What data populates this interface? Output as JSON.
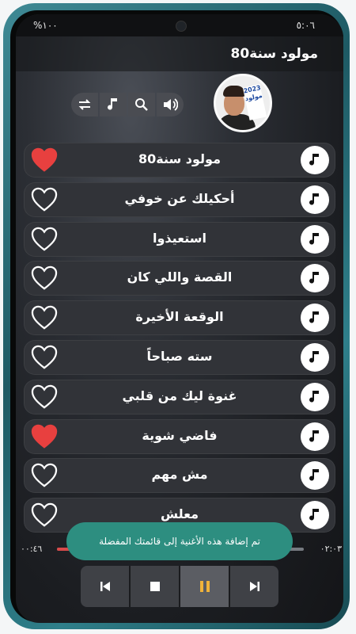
{
  "status": {
    "left": "%١٠٠",
    "right": "٥:٠٦"
  },
  "appbar": {
    "title": "مولود سنة80"
  },
  "album": {
    "badge_text": "2023 مولود"
  },
  "controls": [
    {
      "icon": "repeat-icon"
    },
    {
      "icon": "music-note-icon"
    },
    {
      "icon": "search-icon"
    },
    {
      "icon": "volume-icon"
    }
  ],
  "songs": [
    {
      "title": "مولود سنة80",
      "favorite": true
    },
    {
      "title": "أحكيلك عن خوفي",
      "favorite": false
    },
    {
      "title": "استعيذوا",
      "favorite": false
    },
    {
      "title": "القصة واللي كان",
      "favorite": false
    },
    {
      "title": "الوقعة الأخيرة",
      "favorite": false
    },
    {
      "title": "سته صباحاً",
      "favorite": false
    },
    {
      "title": "غنوة ليك من قلبي",
      "favorite": false
    },
    {
      "title": "فاضي شوية",
      "favorite": true
    },
    {
      "title": "مش مهم",
      "favorite": false
    },
    {
      "title": "معلش",
      "favorite": false
    }
  ],
  "toast": {
    "message": "تم إضافة هذه الأغنية إلى قائمتك المفضلة"
  },
  "progress": {
    "elapsed": "٠٠:٤٦",
    "total": "٠٢:٠٣",
    "fraction": 0.37
  },
  "player": {
    "buttons": [
      {
        "name": "previous-button",
        "icon": "skip-previous-icon"
      },
      {
        "name": "stop-button",
        "icon": "stop-icon"
      },
      {
        "name": "pause-button",
        "icon": "pause-icon"
      },
      {
        "name": "next-button",
        "icon": "skip-next-icon"
      }
    ]
  },
  "colors": {
    "favorite": "#e8403f",
    "toast": "#2d8e80",
    "row": "#313338",
    "progress": "#d84a4a"
  }
}
